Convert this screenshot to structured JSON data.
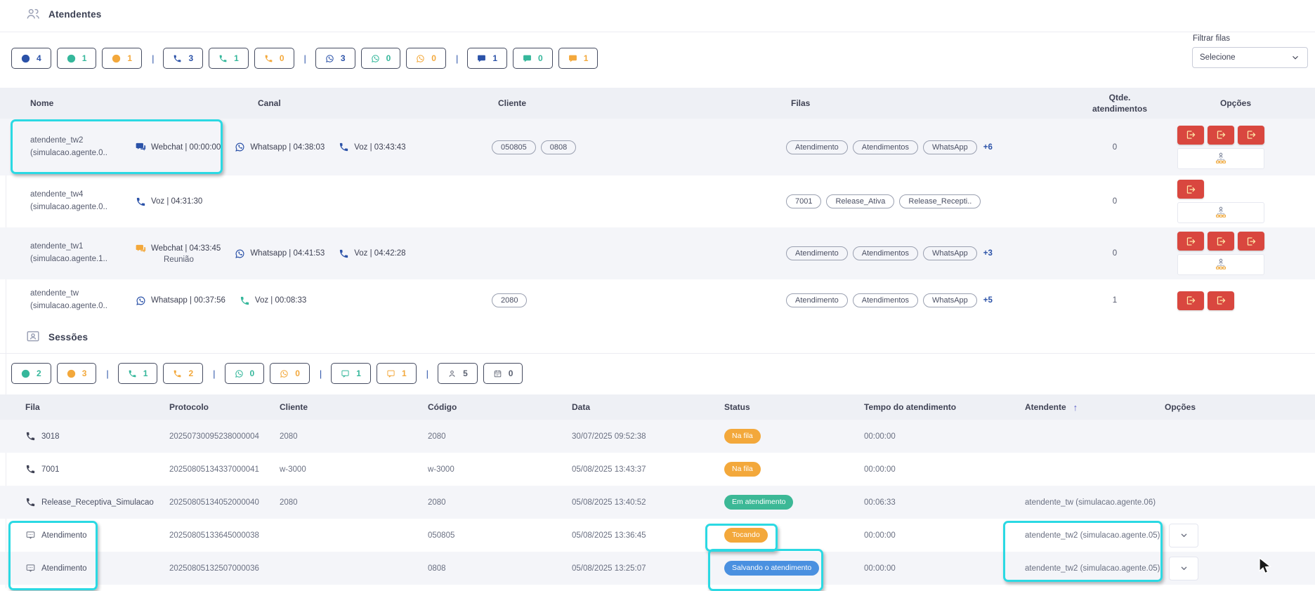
{
  "colors": {
    "blue": "#2b52a8",
    "green": "#35b79b",
    "orange": "#f3a83b",
    "red": "#d9473f",
    "cyan_highlight": "#2bd9e3",
    "status_blue": "#4a90e0"
  },
  "atendentes": {
    "title": "Atendentes",
    "filter_label": "Filtrar filas",
    "filter_value": "Selecione",
    "counters": [
      {
        "icon": "circle",
        "color": "blue",
        "value": "4"
      },
      {
        "icon": "circle",
        "color": "green",
        "value": "1"
      },
      {
        "icon": "circle",
        "color": "orange",
        "value": "1"
      },
      {
        "divider": "|"
      },
      {
        "icon": "phone",
        "color": "blue",
        "value": "3"
      },
      {
        "icon": "phone",
        "color": "green",
        "value": "1"
      },
      {
        "icon": "phone",
        "color": "orange",
        "value": "0"
      },
      {
        "divider": "|"
      },
      {
        "icon": "whatsapp",
        "color": "blue",
        "value": "3"
      },
      {
        "icon": "whatsapp",
        "color": "green",
        "value": "0"
      },
      {
        "icon": "whatsapp",
        "color": "orange",
        "value": "0"
      },
      {
        "divider": "|"
      },
      {
        "icon": "chat",
        "color": "blue",
        "value": "1"
      },
      {
        "icon": "chat",
        "color": "green",
        "value": "0"
      },
      {
        "icon": "chat",
        "color": "orange",
        "value": "1"
      }
    ],
    "headers": [
      "Nome",
      "Canal",
      "Cliente",
      "Filas",
      "Qtde. atendimentos",
      "Opções"
    ],
    "rows": [
      {
        "name_line1": "atendente_tw2",
        "name_line2": "(simulacao.agente.0..",
        "channels": [
          {
            "icon": "webchat",
            "color": "blue",
            "label": "Webchat | 00:00:00"
          },
          {
            "icon": "whatsapp",
            "color": "blue",
            "label": "Whatsapp | 04:38:03"
          },
          {
            "icon": "phone",
            "color": "blue",
            "label": "Voz | 03:43:43"
          }
        ],
        "clientes": [
          "050805",
          "0808"
        ],
        "filas": [
          "Atendimento",
          "Atendimentos",
          "WhatsApp"
        ],
        "filas_more": "+6",
        "qtde": "0",
        "logout_buttons": 3,
        "has_org_button": true
      },
      {
        "name_line1": "atendente_tw4",
        "name_line2": "(simulacao.agente.0..",
        "channels": [
          {
            "icon": "phone",
            "color": "blue",
            "label": "Voz | 04:31:30"
          }
        ],
        "clientes": [],
        "filas": [
          "7001",
          "Release_Ativa",
          "Release_Recepti.."
        ],
        "filas_more": "",
        "qtde": "0",
        "logout_buttons": 1,
        "has_org_button": true
      },
      {
        "name_line1": "atendente_tw1",
        "name_line2": "(simulacao.agente.1..",
        "channels": [
          {
            "icon": "webchat",
            "color": "orange",
            "label": "Webchat | 04:33:45",
            "sublabel": "Reunião"
          },
          {
            "icon": "whatsapp",
            "color": "blue",
            "label": "Whatsapp | 04:41:53"
          },
          {
            "icon": "phone",
            "color": "blue",
            "label": "Voz | 04:42:28"
          }
        ],
        "clientes": [],
        "filas": [
          "Atendimento",
          "Atendimentos",
          "WhatsApp"
        ],
        "filas_more": "+3",
        "qtde": "0",
        "logout_buttons": 3,
        "has_org_button": true
      },
      {
        "name_line1": "atendente_tw",
        "name_line2": "(simulacao.agente.0..",
        "channels": [
          {
            "icon": "whatsapp",
            "color": "blue",
            "label": "Whatsapp | 00:37:56"
          },
          {
            "icon": "phone",
            "color": "green",
            "label": "Voz | 00:08:33"
          }
        ],
        "clientes": [
          "2080"
        ],
        "filas": [
          "Atendimento",
          "Atendimentos",
          "WhatsApp"
        ],
        "filas_more": "+5",
        "qtde": "1",
        "logout_buttons": 2,
        "has_org_button": false
      }
    ]
  },
  "sessoes": {
    "title": "Sessões",
    "counters": [
      {
        "icon": "circle",
        "color": "green",
        "value": "2"
      },
      {
        "icon": "circle",
        "color": "orange",
        "value": "3"
      },
      {
        "divider": "|"
      },
      {
        "icon": "phone",
        "color": "green",
        "value": "1"
      },
      {
        "icon": "phone",
        "color": "orange",
        "value": "2"
      },
      {
        "divider": "|"
      },
      {
        "icon": "whatsapp",
        "color": "green",
        "value": "0"
      },
      {
        "icon": "whatsapp",
        "color": "orange",
        "value": "0"
      },
      {
        "divider": "|"
      },
      {
        "icon": "chat-square",
        "color": "green",
        "value": "1"
      },
      {
        "icon": "chat-square",
        "color": "orange",
        "value": "1"
      },
      {
        "divider": "|"
      },
      {
        "icon": "person",
        "color": "grey",
        "value": "5"
      },
      {
        "icon": "calendar",
        "color": "grey",
        "value": "0"
      }
    ],
    "headers": [
      "Fila",
      "Protocolo",
      "Cliente",
      "Código",
      "Data",
      "Status",
      "Tempo do atendimento",
      "Atendente",
      "Opções"
    ],
    "sort_arrow": "↑",
    "rows": [
      {
        "fila_icon": "phone",
        "fila": "3018",
        "protocolo": "20250730095238000004",
        "cliente": "2080",
        "codigo": "2080",
        "data": "30/07/2025 09:52:38",
        "status": "Na fila",
        "status_color": "orange",
        "tempo": "00:00:00",
        "atendente": "",
        "has_menu": false
      },
      {
        "fila_icon": "phone",
        "fila": "7001",
        "protocolo": "20250805134337000041",
        "cliente": "w-3000",
        "codigo": "w-3000",
        "data": "05/08/2025 13:43:37",
        "status": "Na fila",
        "status_color": "orange",
        "tempo": "00:00:00",
        "atendente": "",
        "has_menu": false
      },
      {
        "fila_icon": "phone",
        "fila": "Release_Receptiva_Simulacao",
        "protocolo": "20250805134052000040",
        "cliente": "2080",
        "codigo": "2080",
        "data": "05/08/2025 13:40:52",
        "status": "Em atendimento",
        "status_color": "green",
        "tempo": "00:06:33",
        "atendente": "atendente_tw (simulacao.agente.06)",
        "has_menu": false
      },
      {
        "fila_icon": "webchat-square",
        "fila": "Atendimento",
        "protocolo": "20250805133645000038",
        "cliente": "",
        "codigo": "050805",
        "data": "05/08/2025 13:36:45",
        "status": "Tocando",
        "status_color": "orange",
        "tempo": "00:00:00",
        "atendente": "atendente_tw2 (simulacao.agente.05)",
        "has_menu": true
      },
      {
        "fila_icon": "webchat-square",
        "fila": "Atendimento",
        "protocolo": "20250805132507000036",
        "cliente": "",
        "codigo": "0808",
        "data": "05/08/2025 13:25:07",
        "status": "Salvando o atendimento",
        "status_color": "blue",
        "tempo": "00:00:00",
        "atendente": "atendente_tw2 (simulacao.agente.05)",
        "has_menu": true
      }
    ]
  }
}
